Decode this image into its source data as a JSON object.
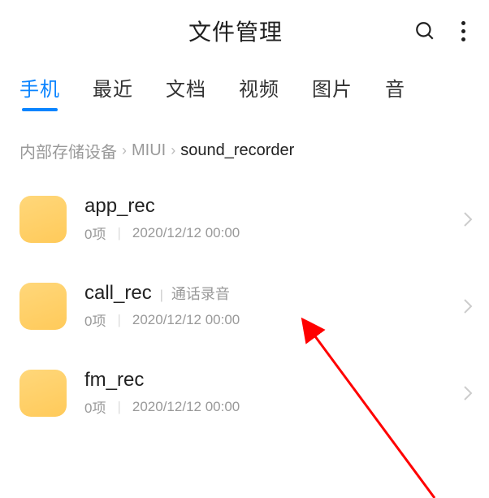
{
  "header": {
    "title": "文件管理"
  },
  "tabs": [
    {
      "label": "手机",
      "active": true
    },
    {
      "label": "最近",
      "active": false
    },
    {
      "label": "文档",
      "active": false
    },
    {
      "label": "视频",
      "active": false
    },
    {
      "label": "图片",
      "active": false
    },
    {
      "label": "音",
      "active": false
    }
  ],
  "breadcrumb": {
    "parts": [
      {
        "label": "内部存储设备",
        "current": false
      },
      {
        "label": "MIUI",
        "current": false
      },
      {
        "label": "sound_recorder",
        "current": true
      }
    ],
    "separator": "›"
  },
  "items": [
    {
      "name": "app_rec",
      "tag": "",
      "count": "0项",
      "date": "2020/12/12 00:00"
    },
    {
      "name": "call_rec",
      "tag": "通话录音",
      "count": "0项",
      "date": "2020/12/12 00:00"
    },
    {
      "name": "fm_rec",
      "tag": "",
      "count": "0项",
      "date": "2020/12/12 00:00"
    }
  ]
}
